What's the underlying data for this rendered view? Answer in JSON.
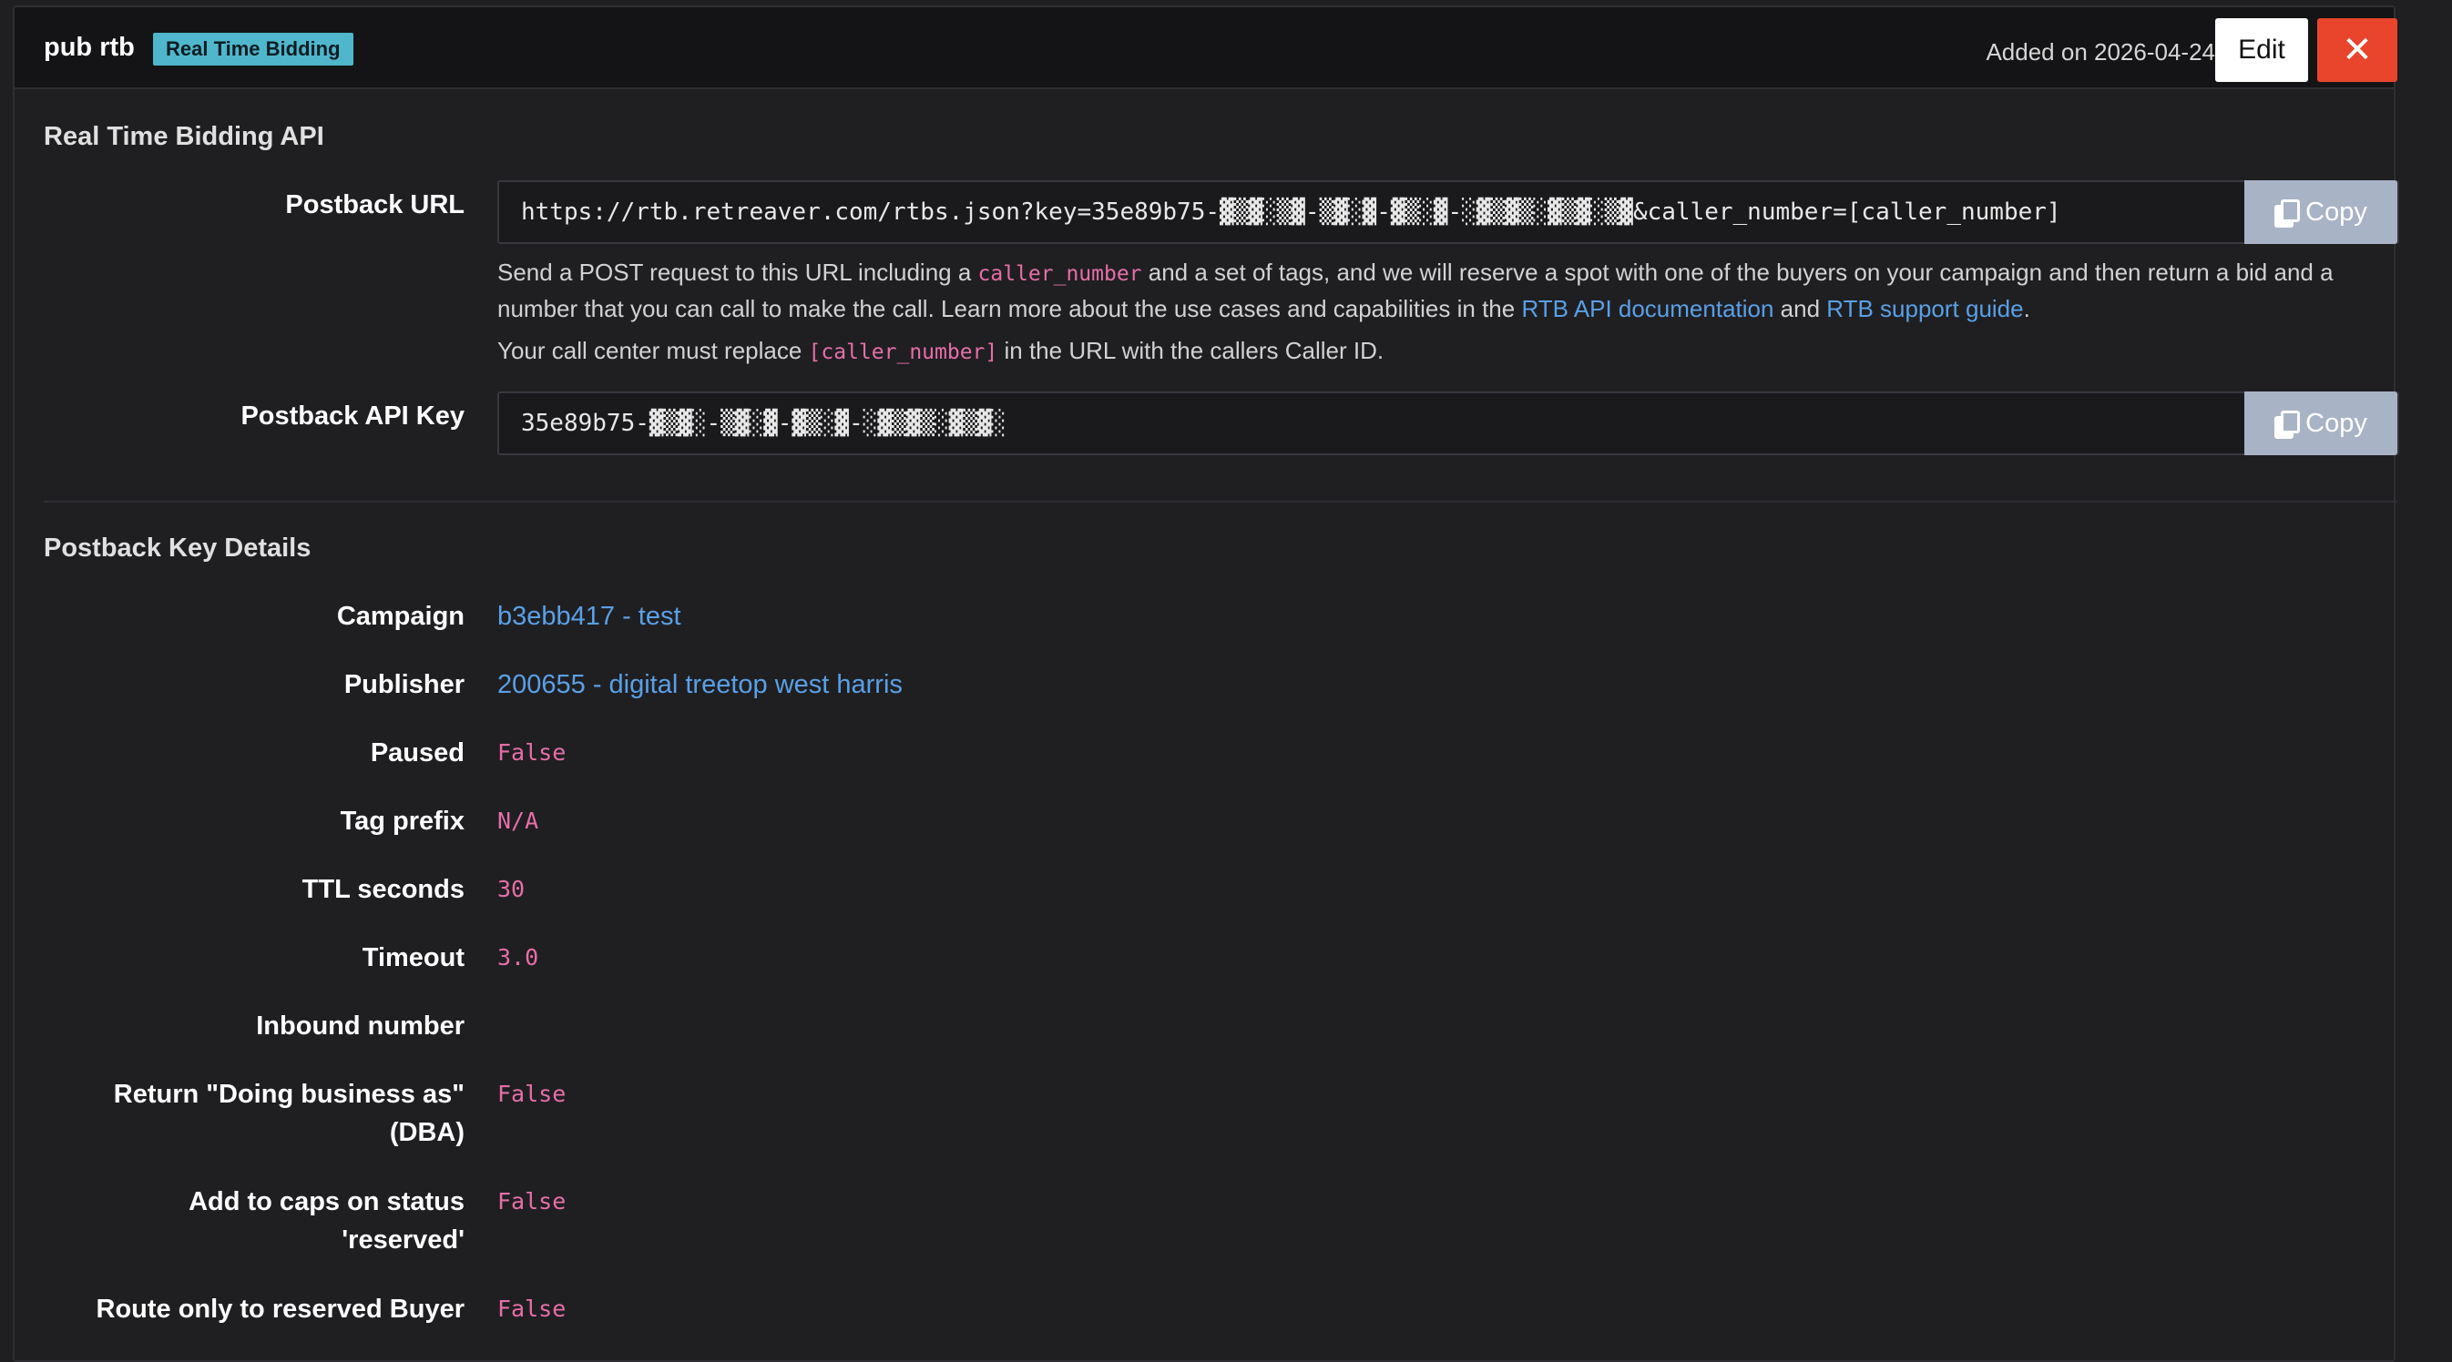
{
  "header": {
    "title": "pub rtb",
    "badge": "Real Time Bidding",
    "added": "Added on 2026-04-24",
    "edit_label": "Edit",
    "close_glyph": "✕"
  },
  "rtb_api": {
    "section_title": "Real Time Bidding API",
    "postback_url": {
      "label": "Postback URL",
      "value": "https://rtb.retreaver.com/rtbs.json?key=35e89b75-▓▒▓░▒▓-▒▓░▓-▓▒░▓-░▓▒▓▒░▓▒▓░▒▓&caller_number=[caller_number]",
      "copy_label": "Copy",
      "help_part1": "Send a POST request to this URL including a ",
      "help_code1": "caller_number",
      "help_part2": " and a set of tags, and we will reserve a spot with one of the buyers on your campaign and then return a bid and a number that you can call to make the call. Learn more about the use cases and capabilities in the ",
      "help_link1": "RTB API documentation",
      "help_part3": " and ",
      "help_link2": "RTB support guide",
      "help_part4": ".",
      "help2_part1": "Your call center must replace ",
      "help2_code": "[caller_number]",
      "help2_part2": " in the URL with the callers Caller ID."
    },
    "postback_api_key": {
      "label": "Postback API Key",
      "value": "35e89b75-▓▒▓░-▒▓░▓-▓▒░▓-░▓▒▓▒░▓▒▓░",
      "copy_label": "Copy"
    }
  },
  "details": {
    "section_title": "Postback Key Details",
    "campaign": {
      "label": "Campaign",
      "value": "b3ebb417 - test"
    },
    "publisher": {
      "label": "Publisher",
      "value": "200655 - digital treetop west harris"
    },
    "paused": {
      "label": "Paused",
      "value": "False"
    },
    "tag_prefix": {
      "label": "Tag prefix",
      "value": "N/A"
    },
    "ttl_seconds": {
      "label": "TTL seconds",
      "value": "30"
    },
    "timeout": {
      "label": "Timeout",
      "value": "3.0"
    },
    "inbound_number": {
      "label": "Inbound number",
      "value": ""
    },
    "return_dba": {
      "label_line1": "Return \"Doing business as\"",
      "label_line2": "(DBA)",
      "value": "False"
    },
    "add_to_caps": {
      "label_line1": "Add to caps on status",
      "label_line2": "'reserved'",
      "value": "False"
    },
    "route_reserved": {
      "label": "Route only to reserved Buyer",
      "value": "False"
    }
  },
  "colors": {
    "badge": "#4fb6cc",
    "close": "#e8452c",
    "copy": "#a9b3c6",
    "link": "#5aa0e6",
    "code": "#e76ea8"
  }
}
